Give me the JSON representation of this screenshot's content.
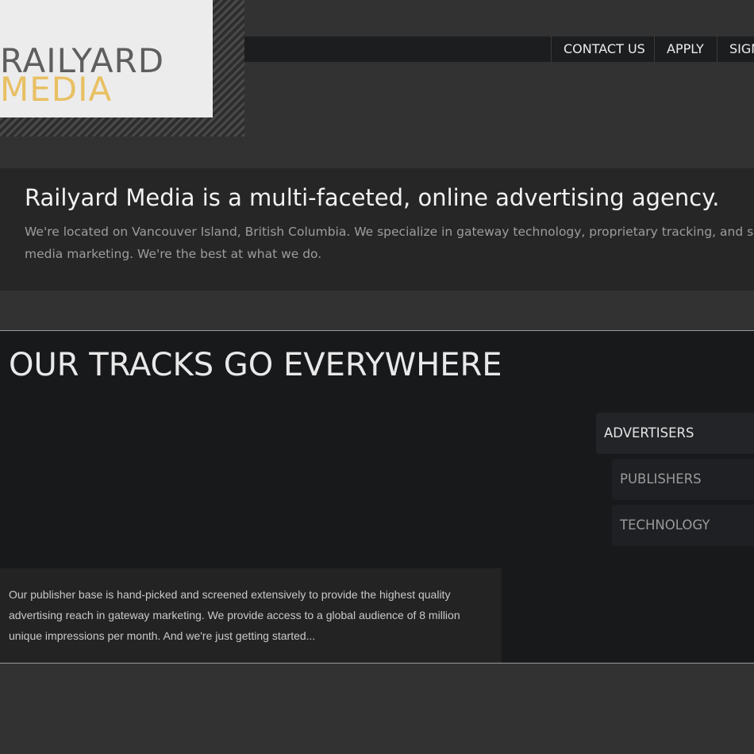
{
  "header": {
    "logo": {
      "line1": "RAILYARD",
      "line2": "MEDIA"
    },
    "nav": [
      "CONTACT US",
      "APPLY",
      "SIGN"
    ]
  },
  "intro": {
    "title": "Railyard Media is a multi-faceted, online advertising agency.",
    "body": "We're located on Vancouver Island, British Columbia. We specialize in gateway technology, proprietary tracking, and social media marketing. We're the best at what we do."
  },
  "tracks": {
    "heading": "OUR TRACKS GO EVERYWHERE",
    "tabs": [
      "ADVERTISERS",
      "PUBLISHERS",
      "TECHNOLOGY"
    ],
    "active_tab": "ADVERTISERS",
    "description": "Our publisher base is hand-picked and screened extensively to provide the highest quality advertising reach in gateway marketing. We provide access to a global audience of 8 million unique impressions per month. And we're just getting started..."
  },
  "colors": {
    "accent": "#e8c063",
    "background": "#323232",
    "panel": "#18191b"
  }
}
